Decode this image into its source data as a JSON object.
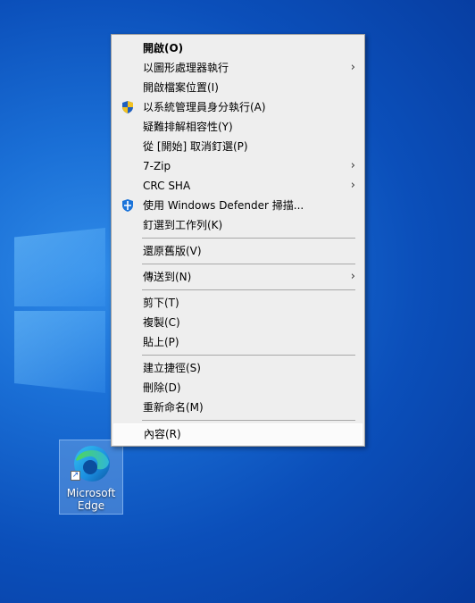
{
  "desktop": {
    "icon_label": "Microsoft Edge"
  },
  "context_menu": {
    "groups": [
      [
        {
          "label": "開啟(O)",
          "bold": true
        },
        {
          "label": "以圖形處理器執行",
          "submenu": true
        },
        {
          "label": "開啟檔案位置(I)"
        },
        {
          "label": "以系統管理員身分執行(A)",
          "icon": "uac-shield-icon"
        },
        {
          "label": "疑難排解相容性(Y)"
        },
        {
          "label": "從 [開始] 取消釘選(P)"
        },
        {
          "label": "7-Zip",
          "submenu": true
        },
        {
          "label": "CRC SHA",
          "submenu": true
        },
        {
          "label": "使用 Windows Defender 掃描...",
          "icon": "defender-icon"
        },
        {
          "label": "釘選到工作列(K)"
        }
      ],
      [
        {
          "label": "還原舊版(V)"
        }
      ],
      [
        {
          "label": "傳送到(N)",
          "submenu": true
        }
      ],
      [
        {
          "label": "剪下(T)"
        },
        {
          "label": "複製(C)"
        },
        {
          "label": "貼上(P)"
        }
      ],
      [
        {
          "label": "建立捷徑(S)"
        },
        {
          "label": "刪除(D)"
        },
        {
          "label": "重新命名(M)"
        }
      ],
      [
        {
          "label": "內容(R)",
          "hover": true
        }
      ]
    ],
    "submenu_arrow": "›"
  }
}
